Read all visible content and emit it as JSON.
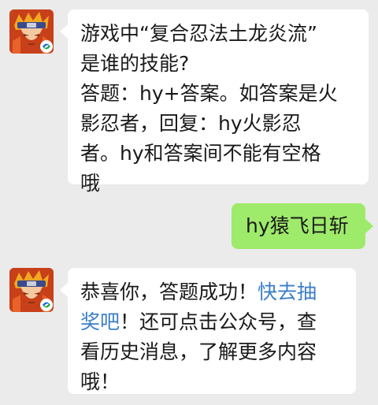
{
  "colors": {
    "chat_background": "#ebebeb",
    "incoming_bubble": "#ffffff",
    "outgoing_bubble": "#9eea6a",
    "link": "#3a7ec9",
    "text": "#1a1a1a"
  },
  "messages": [
    {
      "sender": "bot",
      "avatar_icon": "naruto-avatar-icon",
      "lines": [
        "游戏中“复合忍法土龙炎流”",
        "是谁的技能?",
        "答题：hy+答案。如答案是火",
        "影忍者，回复：hy火影忍",
        "者。hy和答案间不能有空格",
        "哦"
      ]
    },
    {
      "sender": "user",
      "text": "hy猿飞日斩"
    },
    {
      "sender": "bot",
      "avatar_icon": "naruto-avatar-icon",
      "line1_prefix": "恭喜你，答题成功！",
      "line1_link": "快去抽",
      "line2_link": "奖吧",
      "line2_suffix": "！还可点击公众号，查",
      "line3": "看历史消息，了解更多内容",
      "line4": "哦！"
    }
  ]
}
